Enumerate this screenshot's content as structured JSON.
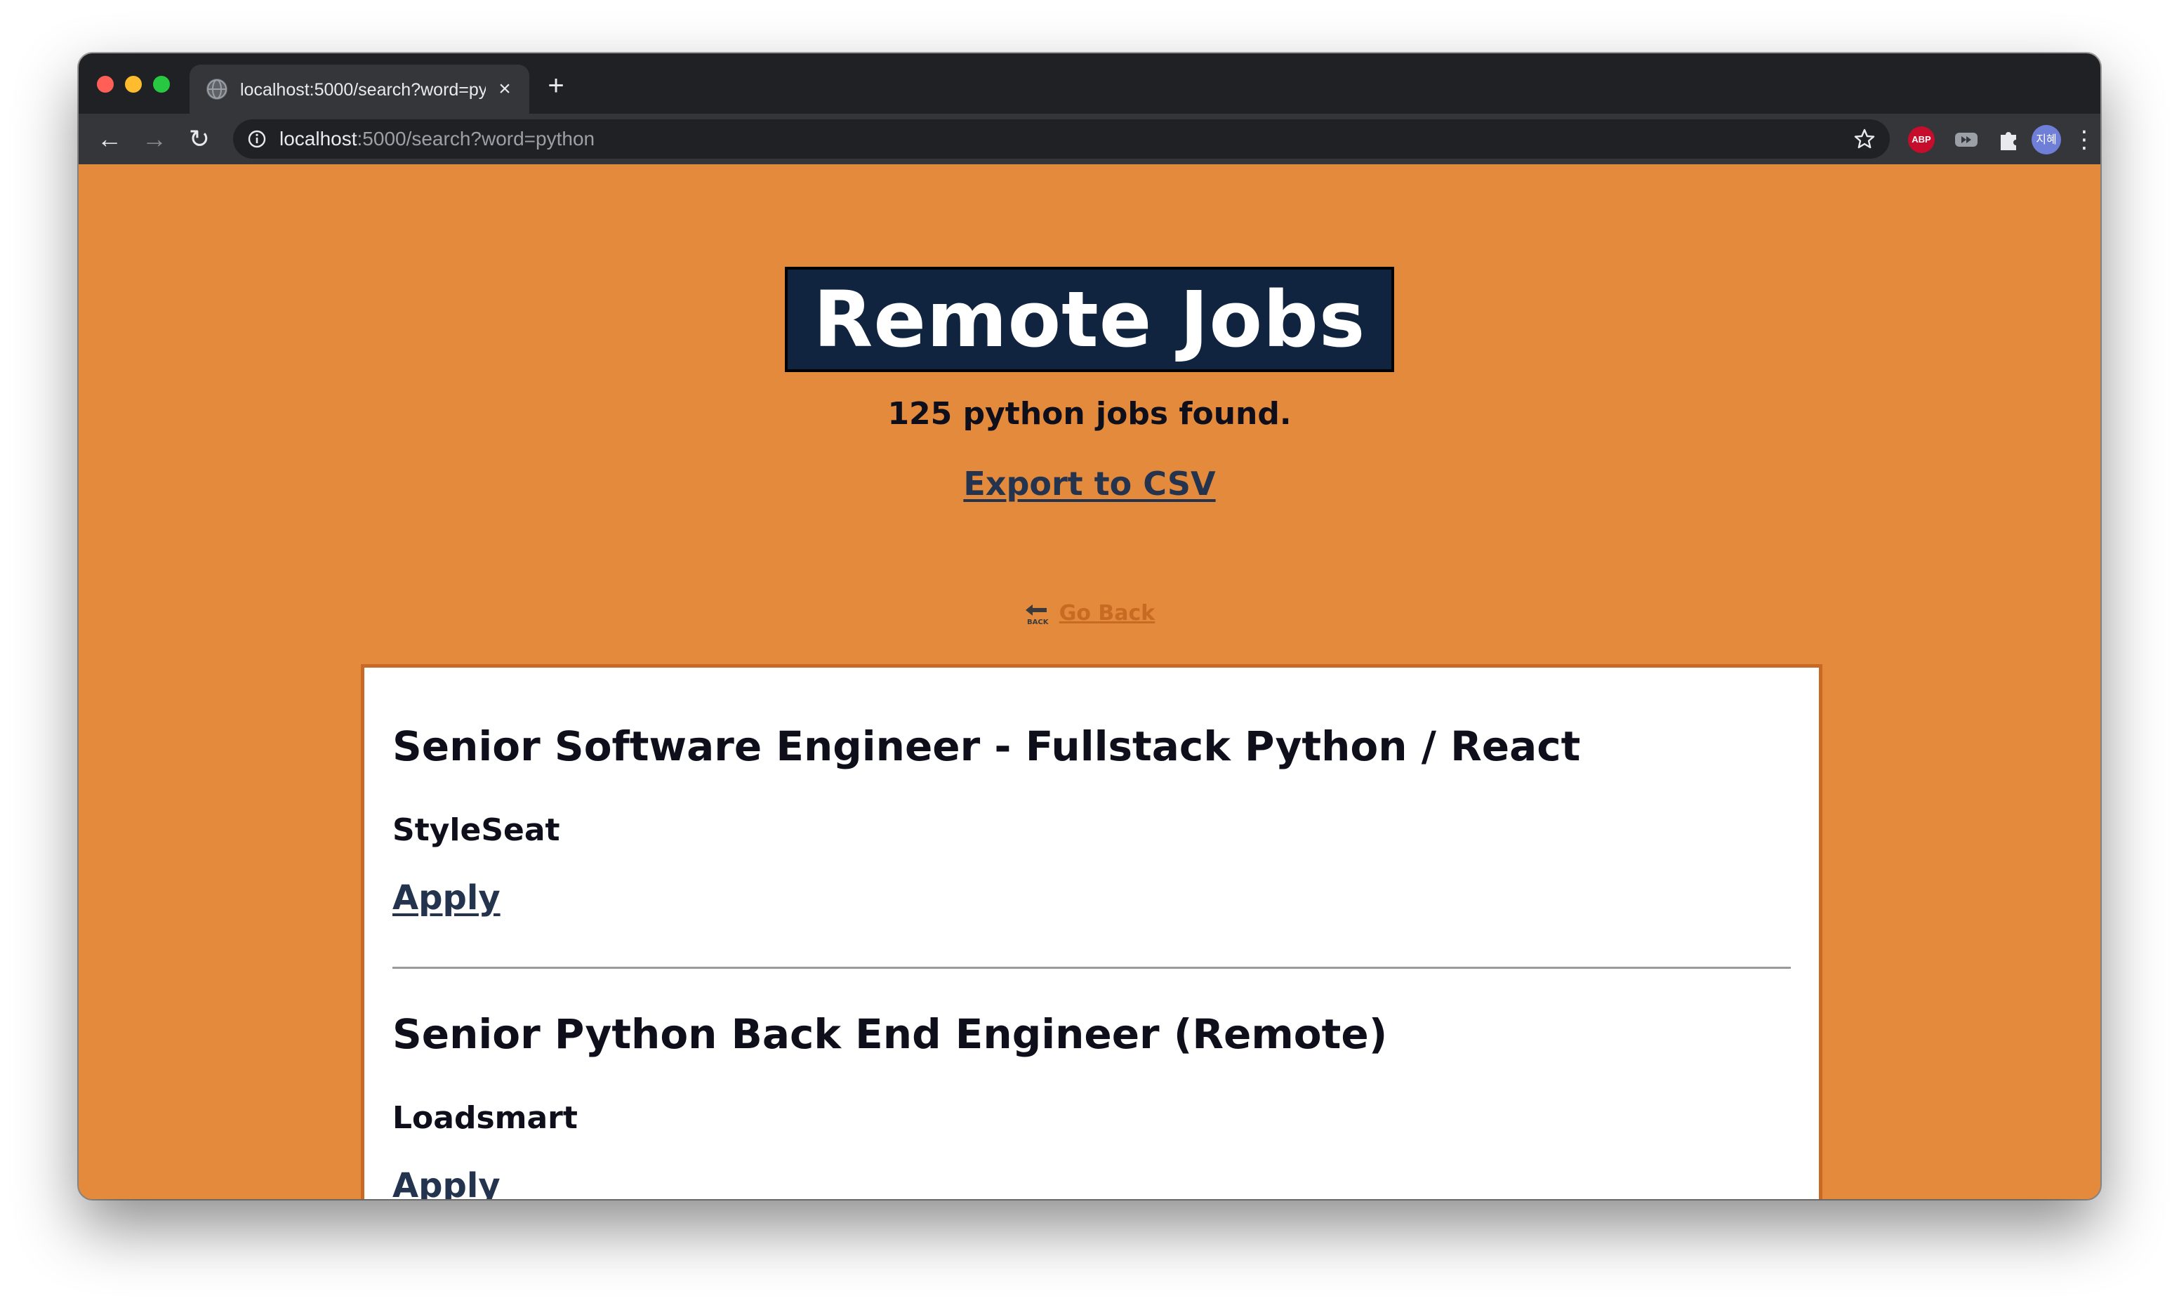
{
  "browser": {
    "tab_title": "localhost:5000/search?word=python",
    "url_host": "localhost",
    "url_rest": ":5000/search?word=python",
    "close_glyph": "×",
    "new_tab_glyph": "+",
    "back_glyph": "←",
    "forward_glyph": "→",
    "reload_glyph": "↻",
    "menu_glyph": "⋮",
    "abp_label": "ABP",
    "avatar_label": "지혜"
  },
  "page": {
    "title": "Remote Jobs",
    "result_count": "125 python jobs found.",
    "export_label": "Export to CSV",
    "go_back_label": "Go Back",
    "back_icon_text": "BACK"
  },
  "jobs": [
    {
      "title": "Senior Software Engineer - Fullstack Python / React",
      "company": "StyleSeat",
      "apply_label": "Apply"
    },
    {
      "title": "Senior Python Back End Engineer (Remote)",
      "company": "Loadsmart",
      "apply_label": "Apply"
    }
  ],
  "colors": {
    "page_background": "#e38a3c",
    "title_box": "#10233f",
    "card_border": "#c96a24",
    "link": "#24344f",
    "go_back_link": "#c86b22"
  }
}
